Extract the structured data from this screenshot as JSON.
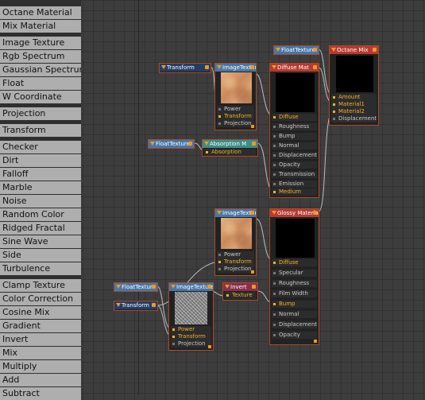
{
  "sidebar": {
    "groups": [
      [
        "Octane Material",
        "Mix Material"
      ],
      [
        "Image Texture",
        "Rgb Spectrum",
        "Gaussian Spectrum",
        "Float",
        "W Coordinate"
      ],
      [
        "Projection"
      ],
      [
        "Transform"
      ],
      [
        "Checker",
        "Dirt",
        "Falloff",
        "Marble",
        "Noise",
        "Random Color",
        "Ridged Fractal",
        "Sine Wave",
        "Side",
        "Turbulence"
      ],
      [
        "Clamp Texture",
        "Color Correction",
        "Cosine Mix",
        "Gradient",
        "Invert",
        "Mix",
        "Multiply",
        "Add",
        "Subtract"
      ]
    ]
  },
  "nodes": {
    "float_texture_top": {
      "title": "FloatTexture"
    },
    "octane_mix": {
      "title": "Octane Mix",
      "ports": [
        "Amount",
        "Material1",
        "Material2",
        "Displacement"
      ]
    },
    "transform_top": {
      "title": "Transform"
    },
    "image_texture_top": {
      "title": "ImageTexture",
      "ports": [
        "Power",
        "Transform",
        "Projection"
      ]
    },
    "diffuse_mat": {
      "title": "Diffuse Mat",
      "ports": [
        "Diffuse",
        "Roughness",
        "Bump",
        "Normal",
        "Displacement",
        "Opacity",
        "Transmission",
        "Emission",
        "Medium"
      ]
    },
    "float_texture_mid": {
      "title": "FloatTexture"
    },
    "absorption": {
      "title": "Absorption M",
      "ports": [
        "Absorption"
      ]
    },
    "image_texture_mid": {
      "title": "ImageTexture",
      "ports": [
        "Power",
        "Transform",
        "Projection"
      ]
    },
    "glossy_material": {
      "title": "Glossy Material",
      "ports": [
        "Diffuse",
        "Specular",
        "Roughness",
        "Film Width",
        "Bump",
        "Normal",
        "Displacement",
        "Opacity"
      ]
    },
    "float_texture_low": {
      "title": "FloatTexture"
    },
    "transform_low": {
      "title": "Transform"
    },
    "image_texture_low": {
      "title": "ImageTexture",
      "ports": [
        "Power",
        "Transform",
        "Projection"
      ]
    },
    "invert": {
      "title": "Invert",
      "ports": [
        "Texture"
      ]
    }
  },
  "colors": {
    "canvas": "#3d3d3d",
    "sidebar_item": "#aeaeae",
    "wire": "#bdbdbd",
    "node_border": "#a84a26",
    "port_active": "#f0b030"
  }
}
